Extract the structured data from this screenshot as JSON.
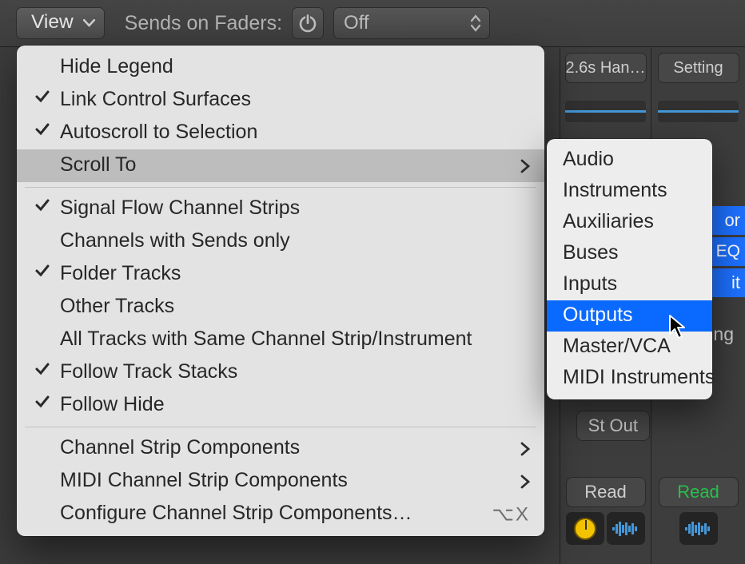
{
  "toolbar": {
    "view_label": "View",
    "sends_label": "Sends on Faders:",
    "off_label": "Off"
  },
  "bg": {
    "chan1_label": "2.6s Han…",
    "chan2_label": "Setting",
    "read1": "Read",
    "read2": "Read",
    "stout": "St Out",
    "pill_or": "or",
    "pill_eq": "EQ",
    "pill_it": "it",
    "ing": "ing"
  },
  "menu": {
    "items": [
      {
        "label": "Hide Legend",
        "checked": false
      },
      {
        "label": "Link Control Surfaces",
        "checked": true
      },
      {
        "label": "Autoscroll to Selection",
        "checked": true
      },
      {
        "label": "Scroll To",
        "checked": false,
        "submenu": true,
        "hover": true
      }
    ],
    "group2": [
      {
        "label": "Signal Flow Channel Strips",
        "checked": true
      },
      {
        "label": "Channels with Sends only",
        "checked": false
      },
      {
        "label": "Folder Tracks",
        "checked": true
      },
      {
        "label": "Other Tracks",
        "checked": false
      },
      {
        "label": "All Tracks with Same Channel Strip/Instrument",
        "checked": false
      },
      {
        "label": "Follow Track Stacks",
        "checked": true
      },
      {
        "label": "Follow Hide",
        "checked": true
      }
    ],
    "group3": [
      {
        "label": "Channel Strip Components",
        "submenu": true
      },
      {
        "label": "MIDI Channel Strip Components",
        "submenu": true
      },
      {
        "label": "Configure Channel Strip Components…",
        "shortcut": "⌥X"
      }
    ]
  },
  "submenu": {
    "items": [
      "Audio",
      "Instruments",
      "Auxiliaries",
      "Buses",
      "Inputs",
      "Outputs",
      "Master/VCA",
      "MIDI Instruments"
    ],
    "selected_index": 5
  }
}
